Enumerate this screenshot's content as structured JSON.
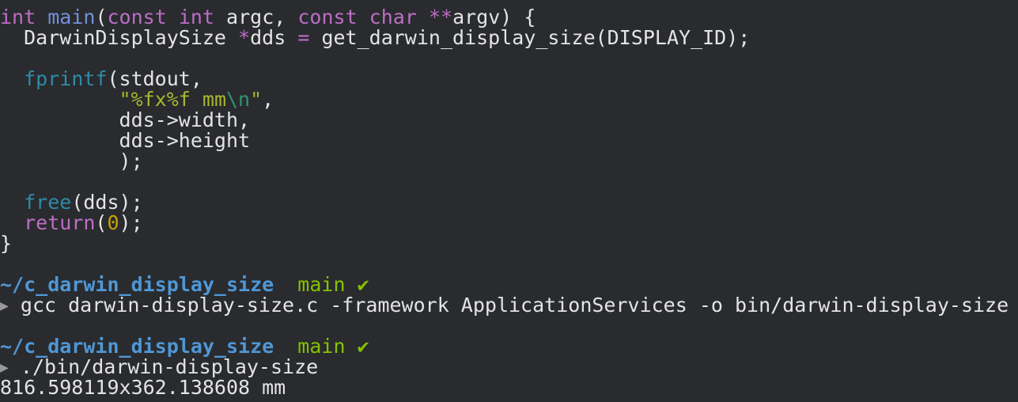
{
  "code": {
    "l1": {
      "kw_int": "int",
      "fn_main": "main",
      "p_open": "(",
      "kw_const1": "const",
      "kw_int2": "int",
      "argc": "argc,",
      "kw_const2": "const",
      "kw_char": "char",
      "ptr": "**",
      "argv": "argv) {"
    },
    "l2": {
      "indent": "  ",
      "type": "DarwinDisplaySize",
      "ptr": "*",
      "rest_a": "dds",
      "eq": "=",
      "call": "get_darwin_display_size(DISPLAY_ID);"
    },
    "l4": {
      "indent": "  ",
      "fn": "fprintf",
      "args": "(stdout,"
    },
    "l5": {
      "indent": "          ",
      "quote_open": "\"",
      "fmt": "%fx%f",
      "space_mm": " mm",
      "esc": "\\n",
      "quote_close": "\"",
      "comma": ","
    },
    "l6": {
      "indent": "          ",
      "text": "dds->width,"
    },
    "l7": {
      "indent": "          ",
      "text": "dds->height"
    },
    "l8": {
      "indent": "          ",
      "text": ");"
    },
    "l10": {
      "indent": "  ",
      "fn": "free",
      "args": "(dds);"
    },
    "l11": {
      "indent": "  ",
      "kw": "return",
      "p_open": "(",
      "num": "0",
      "p_close": ");"
    },
    "l12": {
      "text": "}"
    }
  },
  "prompt1": {
    "path": "~/c_darwin_display_size",
    "branch": "main",
    "check": "✔",
    "arrow": "▶",
    "command": "gcc darwin-display-size.c -framework ApplicationServices -o bin/darwin-display-size"
  },
  "prompt2": {
    "path": "~/c_darwin_display_size",
    "branch": "main",
    "check": "✔",
    "arrow": "▶",
    "command": "./bin/darwin-display-size"
  },
  "output": {
    "result": "816.598119x362.138608 mm"
  }
}
